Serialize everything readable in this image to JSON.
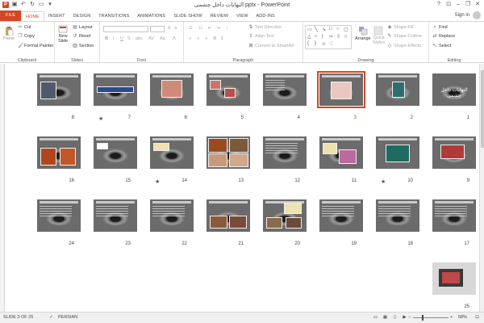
{
  "titlebar": {
    "title": "التهابات داخل چشمی.pptx - PowerPoint",
    "app_icon": "P"
  },
  "tabs": [
    "FILE",
    "HOME",
    "INSERT",
    "DESIGN",
    "TRANSITIONS",
    "ANIMATIONS",
    "SLIDE SHOW",
    "REVIEW",
    "VIEW",
    "ADD-INS"
  ],
  "active_tab": "HOME",
  "account": {
    "signin": "Sign in"
  },
  "ribbon": {
    "clipboard": {
      "label": "Clipboard",
      "paste": "Paste",
      "cut": "Cut",
      "copy": "Copy",
      "format_painter": "Format Painter"
    },
    "slides": {
      "label": "Slides",
      "new_slide": "New",
      "new_slide2": "Slide",
      "layout": "Layout",
      "reset": "Reset",
      "section": "Section"
    },
    "font": {
      "label": "Font"
    },
    "paragraph": {
      "label": "Paragraph",
      "text_direction": "Text Direction",
      "align_text": "Align Text",
      "convert_smartart": "Convert to SmartArt"
    },
    "drawing": {
      "label": "Drawing",
      "arrange": "Arrange",
      "quick_styles": "Quick",
      "quick_styles2": "Styles",
      "shape_fill": "Shape Fill",
      "shape_outline": "Shape Outline",
      "shape_effects": "Shape Effects"
    },
    "editing": {
      "label": "Editing",
      "find": "Find",
      "replace": "Replace",
      "select": "Select"
    }
  },
  "slides": [
    {
      "n": "1"
    },
    {
      "n": "2"
    },
    {
      "n": "3"
    },
    {
      "n": "4"
    },
    {
      "n": "5"
    },
    {
      "n": "6"
    },
    {
      "n": "7"
    },
    {
      "n": "8"
    },
    {
      "n": "9"
    },
    {
      "n": "10"
    },
    {
      "n": "11"
    },
    {
      "n": "12"
    },
    {
      "n": "13"
    },
    {
      "n": "14"
    },
    {
      "n": "15"
    },
    {
      "n": "16"
    },
    {
      "n": "17"
    },
    {
      "n": "18"
    },
    {
      "n": "19"
    },
    {
      "n": "20"
    },
    {
      "n": "21"
    },
    {
      "n": "22"
    },
    {
      "n": "23"
    },
    {
      "n": "24"
    },
    {
      "n": "25"
    }
  ],
  "slide_title_1": "التهابات داخل چشمی",
  "selected_slide": "3",
  "status": {
    "slide_info": "SLIDE 3 OF 25",
    "language": "PERSIAN",
    "zoom": "58%"
  },
  "colors": {
    "accent": "#d24726"
  }
}
